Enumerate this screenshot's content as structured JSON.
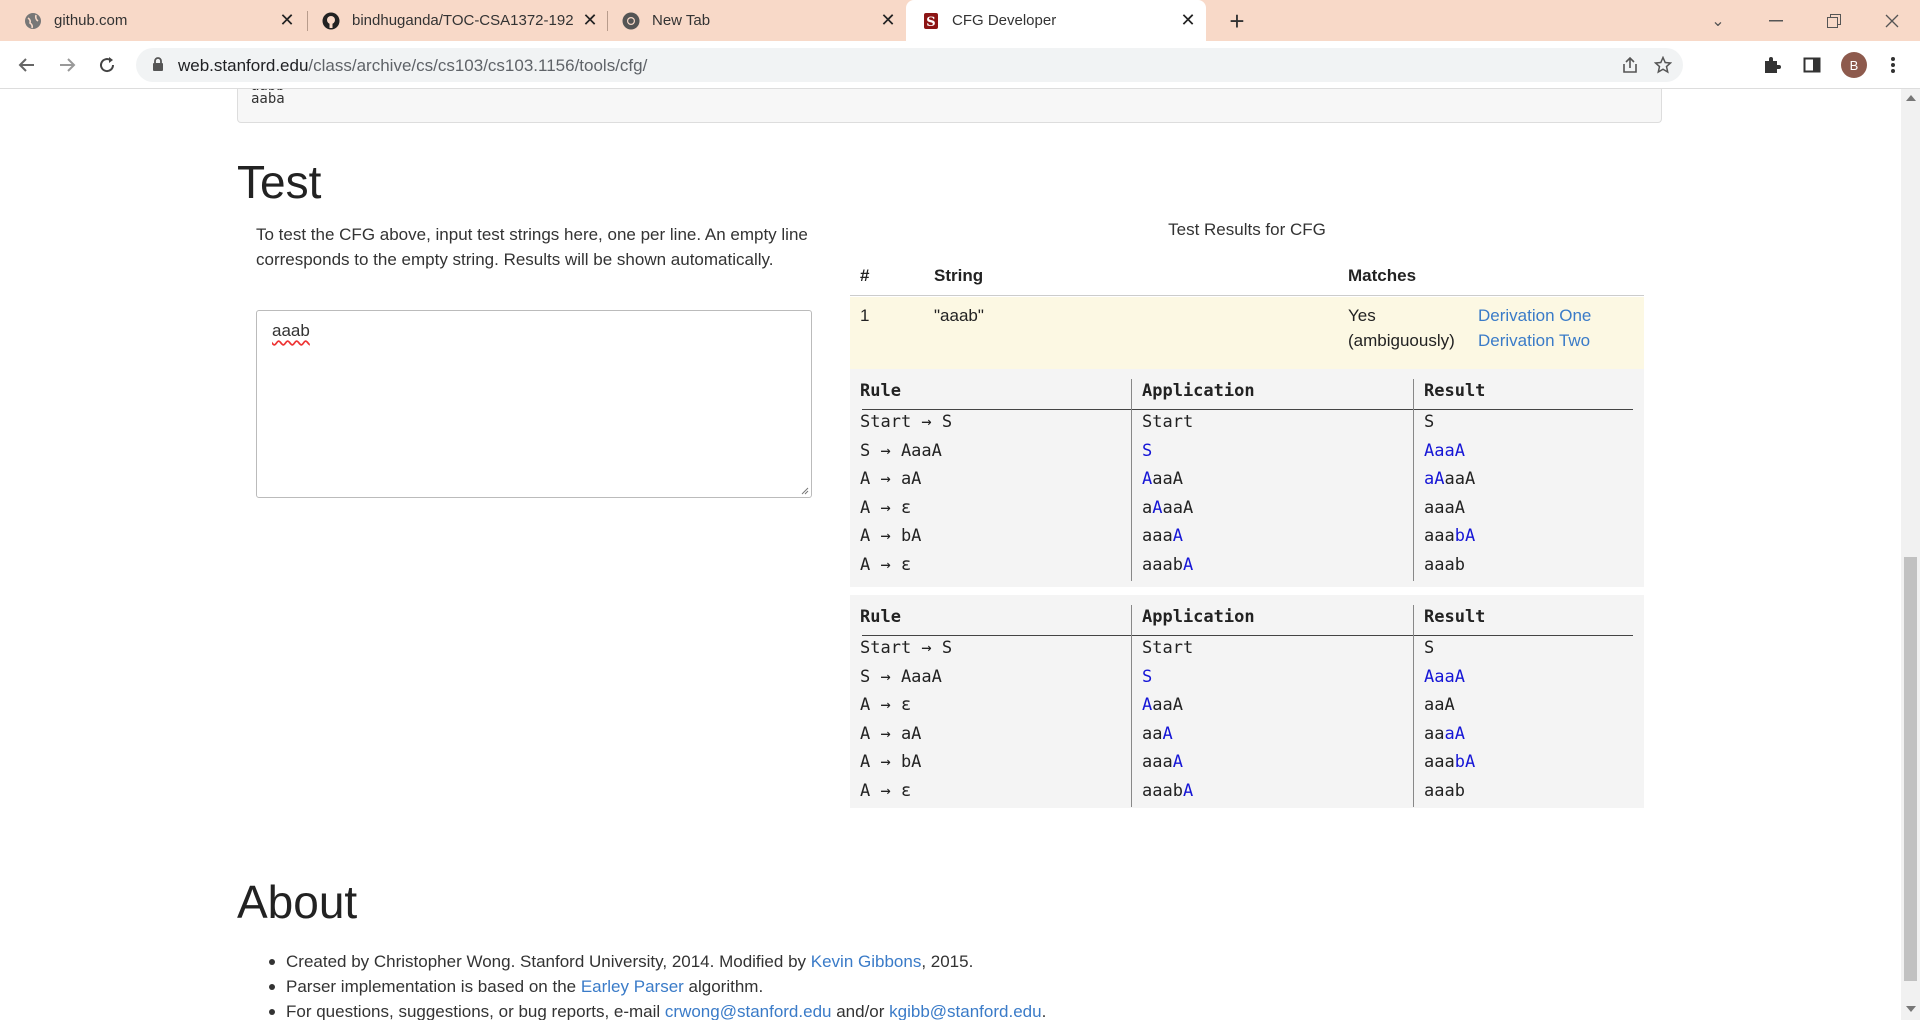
{
  "tabs": [
    {
      "title": "github.com",
      "icon": "globe-icon"
    },
    {
      "title": "bindhuganda/TOC-CSA1372-192",
      "icon": "github-icon"
    },
    {
      "title": "New Tab",
      "icon": "chrome-icon"
    },
    {
      "title": "CFG Developer",
      "icon": "stanford-icon"
    }
  ],
  "toolbar": {
    "url_host": "web.stanford.edu",
    "url_path": "/class/archive/cs/cs103/cs103.1156/tools/cfg/",
    "avatar_letter": "B"
  },
  "previous_box": {
    "lines": [
      "aabb",
      "aaba"
    ]
  },
  "test": {
    "heading": "Test",
    "intro": "To test the CFG above, input test strings here, one per line. An empty line corresponds to the empty string. Results will be shown automatically.",
    "input_value": "aaab"
  },
  "results": {
    "caption": "Test Results for CFG",
    "headers": {
      "num": "#",
      "string": "String",
      "matches": "Matches"
    },
    "row": {
      "num": "1",
      "string": "\"aaab\"",
      "match_line1": "Yes",
      "match_line2": "(ambiguously)",
      "link1": "Derivation One",
      "link2": "Derivation Two"
    },
    "deriv_headers": {
      "rule": "Rule",
      "application": "Application",
      "result": "Result"
    },
    "derivation_one": [
      {
        "rule": "Start → S",
        "app": [
          [
            "Start",
            false
          ]
        ],
        "res": [
          [
            "S",
            false
          ]
        ]
      },
      {
        "rule": "S → AaaA",
        "app": [
          [
            "S",
            true
          ]
        ],
        "res": [
          [
            "AaaA",
            true
          ]
        ]
      },
      {
        "rule": "A → aA",
        "app": [
          [
            "A",
            true
          ],
          [
            "aaA",
            false
          ]
        ],
        "res": [
          [
            "aA",
            true
          ],
          [
            "aaA",
            false
          ]
        ]
      },
      {
        "rule": "A → ε",
        "app": [
          [
            "a",
            false
          ],
          [
            "A",
            true
          ],
          [
            "aaA",
            false
          ]
        ],
        "res": [
          [
            "aaaA",
            false
          ]
        ]
      },
      {
        "rule": "A → bA",
        "app": [
          [
            "aaa",
            false
          ],
          [
            "A",
            true
          ]
        ],
        "res": [
          [
            "aaa",
            false
          ],
          [
            "bA",
            true
          ]
        ]
      },
      {
        "rule": "A → ε",
        "app": [
          [
            "aaab",
            false
          ],
          [
            "A",
            true
          ]
        ],
        "res": [
          [
            "aaab",
            false
          ]
        ]
      }
    ],
    "derivation_two": [
      {
        "rule": "Start → S",
        "app": [
          [
            "Start",
            false
          ]
        ],
        "res": [
          [
            "S",
            false
          ]
        ]
      },
      {
        "rule": "S → AaaA",
        "app": [
          [
            "S",
            true
          ]
        ],
        "res": [
          [
            "AaaA",
            true
          ]
        ]
      },
      {
        "rule": "A → ε",
        "app": [
          [
            "A",
            true
          ],
          [
            "aaA",
            false
          ]
        ],
        "res": [
          [
            "aaA",
            false
          ]
        ]
      },
      {
        "rule": "A → aA",
        "app": [
          [
            "aa",
            false
          ],
          [
            "A",
            true
          ]
        ],
        "res": [
          [
            "aa",
            false
          ],
          [
            "aA",
            true
          ]
        ]
      },
      {
        "rule": "A → bA",
        "app": [
          [
            "aaa",
            false
          ],
          [
            "A",
            true
          ]
        ],
        "res": [
          [
            "aaa",
            false
          ],
          [
            "bA",
            true
          ]
        ]
      },
      {
        "rule": "A → ε",
        "app": [
          [
            "aaab",
            false
          ],
          [
            "A",
            true
          ]
        ],
        "res": [
          [
            "aaab",
            false
          ]
        ]
      }
    ]
  },
  "about": {
    "heading": "About",
    "item1_pre": "Created by Christopher Wong. Stanford University, 2014. Modified by ",
    "item1_link": "Kevin Gibbons",
    "item1_post": ", 2015.",
    "item2_pre": "Parser implementation is based on the ",
    "item2_link": "Earley Parser",
    "item2_post": " algorithm.",
    "item3_pre": "For questions, suggestions, or bug reports, e-mail ",
    "item3_link1": "crwong@stanford.edu",
    "item3_mid": " and/or ",
    "item3_link2": "kgibb@stanford.edu",
    "item3_post": "."
  },
  "colors": {
    "highlight": "#1515d6",
    "link": "#3a7bc8",
    "tabstrip": "#f8d9c8",
    "match_row": "#fcf8e3"
  }
}
